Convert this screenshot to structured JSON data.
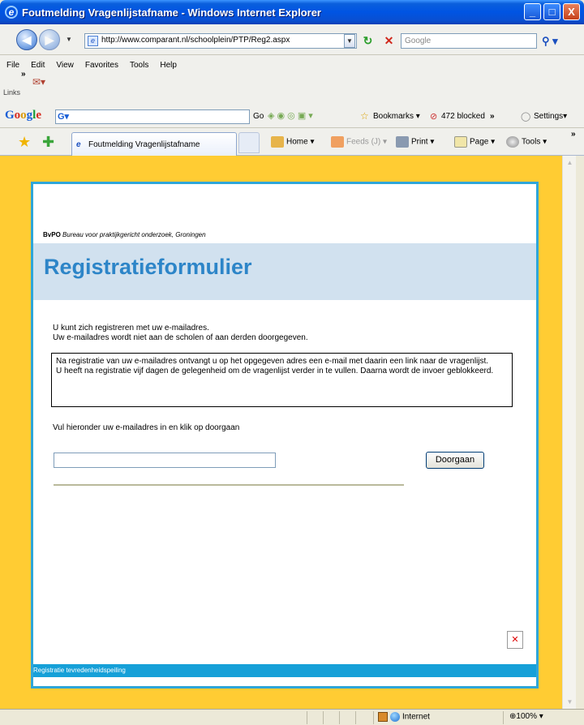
{
  "window": {
    "title": "Foutmelding Vragenlijstafname - Windows Internet Explorer",
    "minimize": "_",
    "maximize": "□",
    "close": "X"
  },
  "address_bar": {
    "url": "http://www.comparant.nl/schoolplein/PTP/Reg2.aspx",
    "search_placeholder": "Google"
  },
  "menu": {
    "items": [
      "File",
      "Edit",
      "View",
      "Favorites",
      "Tools",
      "Help"
    ],
    "links_label": "Links"
  },
  "google_toolbar": {
    "logo": "Google",
    "go": "Go",
    "bookmarks": "Bookmarks",
    "blocked": "472 blocked",
    "settings": "Settings"
  },
  "tab_bar": {
    "tab_title": "Foutmelding Vragenlijstafname",
    "home": "Home",
    "feeds": "Feeds (J)",
    "print": "Print",
    "page": "Page",
    "tools": "Tools"
  },
  "page": {
    "org_abbr": "BvPO",
    "org_name": "Bureau voor praktijkgericht onderzoek, Groningen",
    "heading": "Registratieformulier",
    "intro_line1": "U kunt zich registreren met uw e-mailadres.",
    "intro_line2": "Uw e-mailadres wordt niet aan de scholen of aan derden doorgegeven.",
    "notice_text1": "Na registratie van uw e-mailadres ontvangt u op het opgegeven adres een e-mail met daarin een link naar de vragenlijst.",
    "notice_text2": "U heeft na registratie vijf dagen de gelegenheid om de vragenlijst verder in te vullen. Daarna wordt de invoer geblokkeerd.",
    "instruction": "Vul hieronder uw e-mailadres in en klik op doorgaan",
    "email_value": "",
    "submit_label": "Doorgaan",
    "footer": "Registratie tevredenheidspeiling"
  },
  "status_bar": {
    "zone": "Internet",
    "zoom": "100%"
  },
  "colors": {
    "frame_yellow": "#ffcc33",
    "page_border": "#2fa6d9",
    "banner_bg": "#d1e1ef",
    "heading_blue": "#2d85c8",
    "footer_blue": "#16a0d8"
  }
}
